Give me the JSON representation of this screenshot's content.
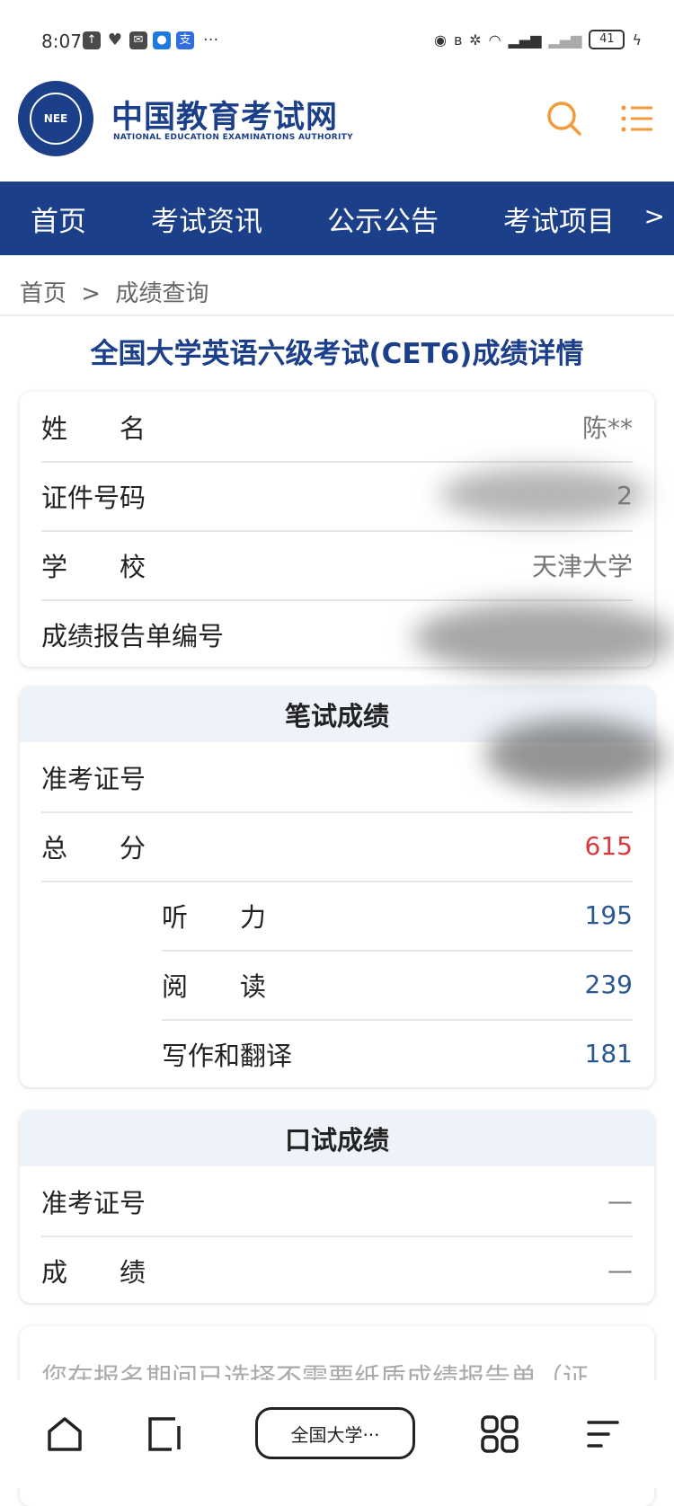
{
  "status_bar": {
    "time": "8:07",
    "battery": "41",
    "app_icons": [
      "upload-icon",
      "heart-icon",
      "mail-icon",
      "bot-icon",
      "alipay-icon"
    ],
    "more": "···"
  },
  "header": {
    "logo_text": "NEE",
    "site_title": "中国教育考试网",
    "site_subtitle": "NATIONAL EDUCATION EXAMINATIONS AUTHORITY",
    "accent_color": "#f29b3c",
    "brand_color": "#1c3f8a"
  },
  "nav": {
    "items": [
      "首页",
      "考试资讯",
      "公示公告",
      "考试项目"
    ],
    "more": ">"
  },
  "breadcrumb": {
    "home": "首页",
    "sep": ">",
    "current": "成绩查询"
  },
  "page_title": "全国大学英语六级考试(CET6)成绩详情",
  "personal_info": {
    "name_label": "姓　　名",
    "name_value": "陈**",
    "id_label": "证件号码",
    "id_value": "2",
    "school_label": "学　　校",
    "school_value": "天津大学",
    "report_label": "成绩报告单编号",
    "report_value": ""
  },
  "written": {
    "title": "笔试成绩",
    "ticket_label": "准考证号",
    "ticket_value": "",
    "total_label": "总　　分",
    "total_value": "615",
    "listening_label": "听　　力",
    "listening_value": "195",
    "reading_label": "阅　　读",
    "reading_value": "239",
    "writing_label": "写作和翻译",
    "writing_value": "181"
  },
  "oral": {
    "title": "口试成绩",
    "ticket_label": "准考证号",
    "ticket_value": "—",
    "score_label": "成　　绩",
    "score_value": "—"
  },
  "notice": "您在报名期间已选择不需要纸质成绩报告单（证",
  "bottom_bar": {
    "tab_label": "全国大学···",
    "icons": [
      "home-icon",
      "tabs-icon",
      "apps-icon",
      "menu-icon"
    ]
  }
}
